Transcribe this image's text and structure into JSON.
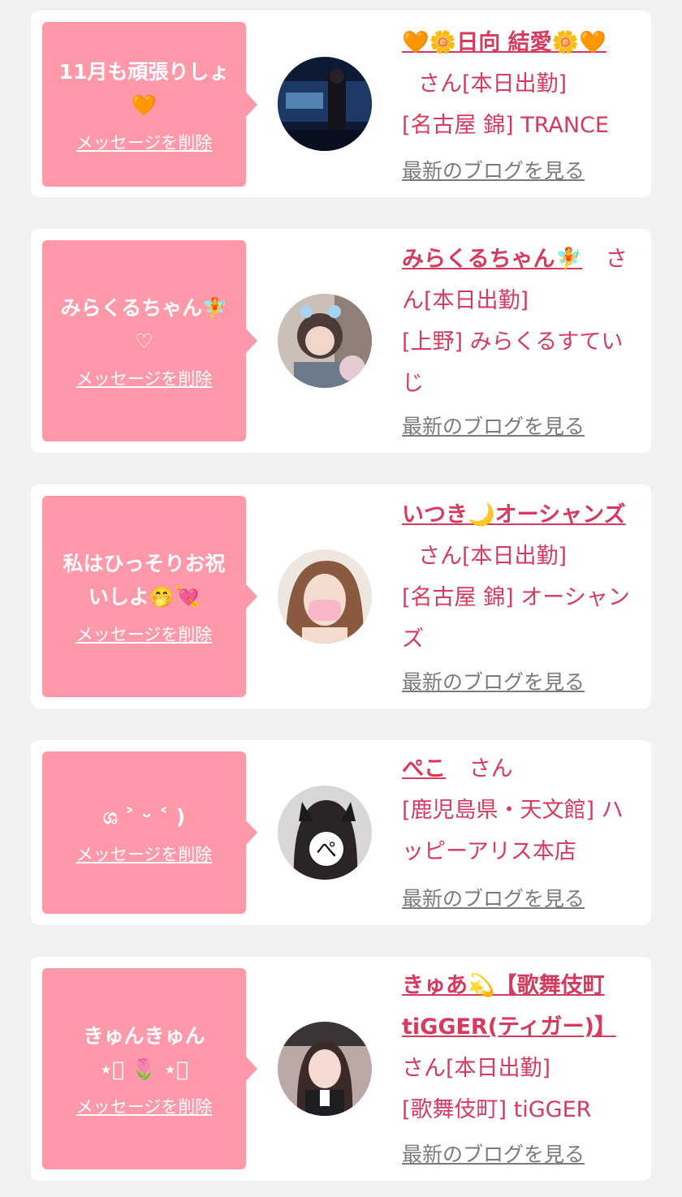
{
  "entries": [
    {
      "message": "11月も頑張りしょ\n🧡",
      "delete_label": "メッセージを削除",
      "name": "🧡🌼日向 結愛🌼🧡",
      "honorific": "さん",
      "status": "[本日出勤]",
      "shop": "[名古屋 錦] TRANCE",
      "blog_label": "最新のブログを見る"
    },
    {
      "message": "みらくるちゃん🧚\n♡",
      "delete_label": "メッセージを削除",
      "name": "みらくるちゃん🧚",
      "honorific": "さん",
      "status": "[本日出勤]",
      "shop": "[上野] みらくるすていじ",
      "blog_label": "最新のブログを見る"
    },
    {
      "message": "私はひっそりお祝\nいしよ🤭💘",
      "delete_label": "メッセージを削除",
      "name": "いつき🌙オーシャンズ",
      "honorific": "さん",
      "status": "[本日出勤]",
      "shop": "[名古屋 錦] オーシャンズ",
      "blog_label": "最新のブログを見る"
    },
    {
      "message": "ශ ˃ ᵕ ˂ )",
      "delete_label": "メッセージを削除",
      "name": "ぺこ",
      "honorific": "さん",
      "status": "",
      "shop": "[鹿児島県・天文館] ハッピーアリス本店",
      "blog_label": "最新のブログを見る"
    },
    {
      "message": "きゅんきゅん\n⋆͛ 🌷 ⋆͛",
      "delete_label": "メッセージを削除",
      "name": "きゅあ💫【歌舞伎町tiGGER(ティガー)】",
      "honorific": "さん",
      "status": "[本日出勤]",
      "shop": "[歌舞伎町] tiGGER",
      "blog_label": "最新のブログを見る"
    }
  ],
  "colors": {
    "page_bg": "#f2f2f2",
    "card_bg": "#ffffff",
    "bubble_bg": "#ff99aa",
    "accent": "#d63a5e",
    "muted": "#7b7b7b"
  },
  "icons": [
    "avatar-photo"
  ]
}
